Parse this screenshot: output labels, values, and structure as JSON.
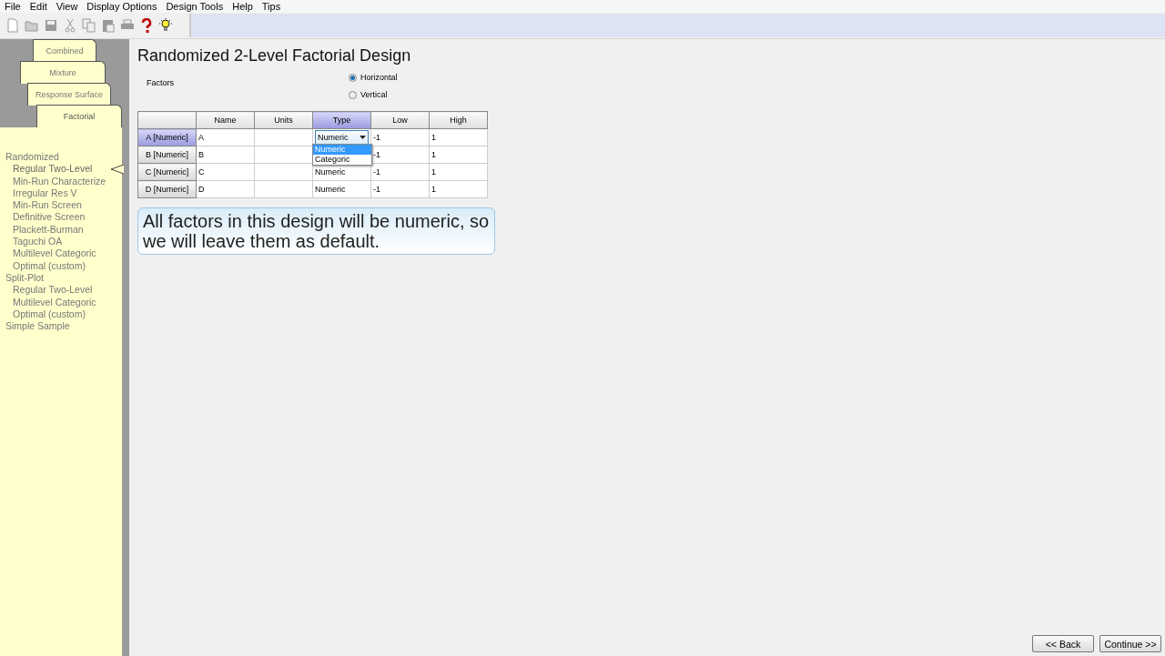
{
  "menu": [
    "File",
    "Edit",
    "View",
    "Display Options",
    "Design Tools",
    "Help",
    "Tips"
  ],
  "toolbar": [
    {
      "kind": "new",
      "disabled": true
    },
    {
      "kind": "open",
      "disabled": true
    },
    {
      "kind": "save",
      "disabled": true
    },
    {
      "kind": "cut",
      "disabled": true
    },
    {
      "kind": "copy",
      "disabled": true
    },
    {
      "kind": "paste",
      "disabled": true
    },
    {
      "kind": "print",
      "disabled": true
    },
    {
      "kind": "help",
      "disabled": false
    },
    {
      "kind": "tip",
      "disabled": false
    }
  ],
  "tabs": [
    {
      "label": "Combined",
      "selected": false
    },
    {
      "label": "Mixture",
      "selected": false
    },
    {
      "label": "Response Surface",
      "selected": false
    },
    {
      "label": "Factorial",
      "selected": true
    }
  ],
  "tree": [
    {
      "label": "Randomized",
      "selected": false,
      "children": [
        {
          "label": "Regular Two-Level",
          "selected": true
        },
        {
          "label": "Min-Run Characterize",
          "selected": false
        },
        {
          "label": "Irregular Res V",
          "selected": false
        },
        {
          "label": "Min-Run Screen",
          "selected": false
        },
        {
          "label": "Definitive Screen",
          "selected": false
        },
        {
          "label": "Plackett-Burman",
          "selected": false
        },
        {
          "label": "Taguchi OA",
          "selected": false
        },
        {
          "label": "Multilevel Categoric",
          "selected": false
        },
        {
          "label": "Optimal (custom)",
          "selected": false
        }
      ]
    },
    {
      "label": "Split-Plot",
      "selected": false,
      "children": [
        {
          "label": "Regular Two-Level",
          "selected": false
        },
        {
          "label": "Multilevel Categoric",
          "selected": false
        },
        {
          "label": "Optimal (custom)",
          "selected": false
        }
      ]
    },
    {
      "label": "Simple Sample",
      "selected": false
    }
  ],
  "title": "Randomized 2-Level Factorial Design",
  "factors_label": "Factors",
  "orientation": [
    {
      "label": "Horizontal",
      "selected": true
    },
    {
      "label": "Vertical",
      "selected": false
    }
  ],
  "table": {
    "columns": [
      {
        "label": "Name",
        "selected": false
      },
      {
        "label": "Units",
        "selected": false
      },
      {
        "label": "Type",
        "selected": true
      },
      {
        "label": "Low",
        "selected": false
      },
      {
        "label": "High",
        "selected": false
      }
    ],
    "rows": [
      {
        "header": "A [Numeric]",
        "selected": true,
        "name": "A",
        "type": "Numeric",
        "low": "-1",
        "high": "1",
        "dropdown": {
          "open": true,
          "options": [
            {
              "label": "Numeric",
              "selected": true
            },
            {
              "label": "Categoric",
              "selected": false
            }
          ]
        }
      },
      {
        "header": "B [Numeric]",
        "selected": false,
        "name": "B",
        "low": "-1",
        "high": "1"
      },
      {
        "header": "C [Numeric]",
        "selected": false,
        "name": "C",
        "type": "Numeric",
        "low": "-1",
        "high": "1"
      },
      {
        "header": "D [Numeric]",
        "selected": false,
        "name": "D",
        "type": "Numeric",
        "low": "-1",
        "high": "1"
      }
    ]
  },
  "callout": "All factors in this design will be numeric, so we will leave them as default.",
  "buttons": [
    "<< Back",
    "Continue >>"
  ]
}
